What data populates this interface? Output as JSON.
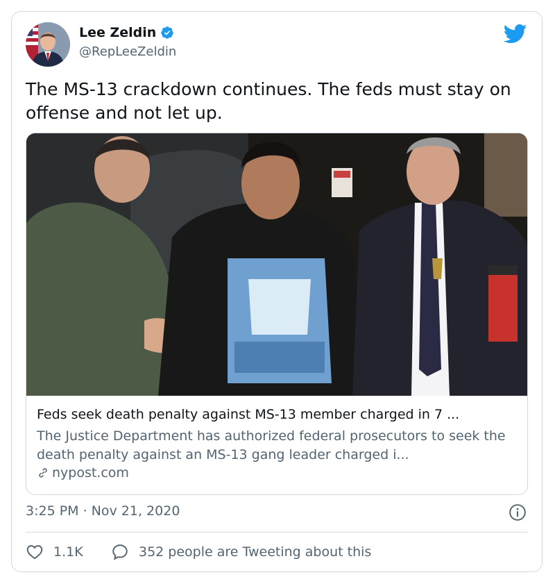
{
  "author": {
    "name": "Lee Zeldin",
    "handle": "@RepLeeZeldin",
    "verified": true,
    "avatar_icon": "portrait-avatar"
  },
  "tweet": {
    "text": "The MS-13 crackdown continues. The feds must stay on offense and not let up."
  },
  "link_card": {
    "image_icon": "news-photo",
    "title": "Feds seek death penalty against MS-13 member charged in 7 ...",
    "description": "The Justice Department has authorized federal prosecutors to seek the death penalty against an MS-13 gang leader charged i...",
    "domain": "nypost.com"
  },
  "meta": {
    "timestamp": "3:25 PM · Nov 21, 2020"
  },
  "engagement": {
    "likes": "1.1K",
    "tweeting": "352 people are Tweeting about this"
  },
  "colors": {
    "brand": "#1d9bf0",
    "text": "#0f1419",
    "secondary": "#536471",
    "border": "#cfd9de"
  }
}
